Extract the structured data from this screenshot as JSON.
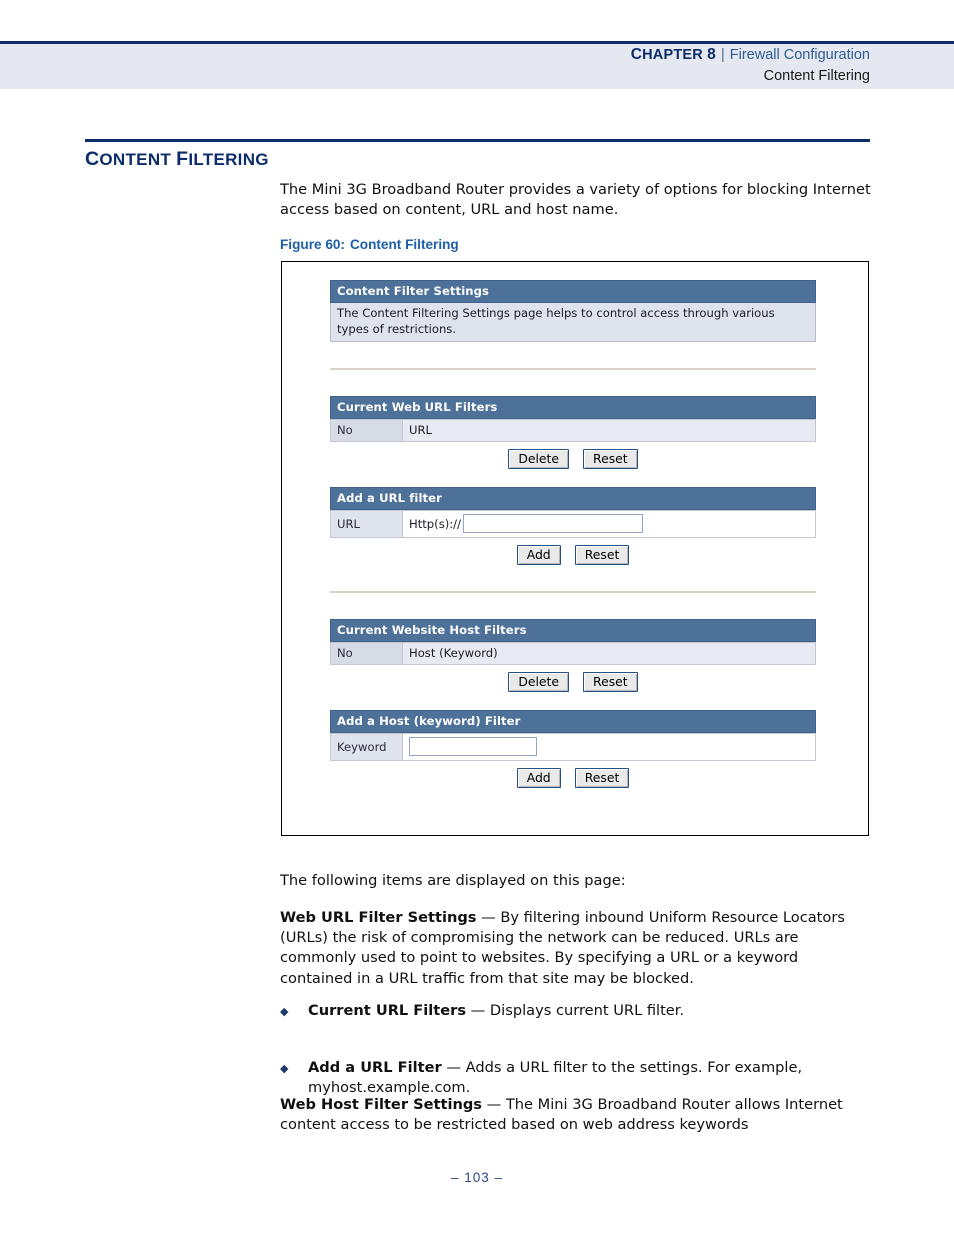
{
  "header": {
    "chapter_label": "Chapter 8",
    "separator": "|",
    "section": "Firewall Configuration",
    "subsection": "Content Filtering"
  },
  "section": {
    "title": "Content Filtering",
    "intro": "The Mini 3G Broadband Router provides a variety of options for blocking Internet access based on content, URL and host name."
  },
  "figure": {
    "caption_label": "Figure 60:",
    "caption_text": "Content Filtering",
    "screenshot": {
      "content_filter_settings": {
        "header": "Content Filter Settings",
        "description": "The Content Filtering Settings page helps to control access through various types of restrictions."
      },
      "current_web_url_filters": {
        "header": "Current Web URL Filters",
        "columns": [
          "No",
          "URL"
        ],
        "rows": [],
        "buttons": [
          "Delete",
          "Reset"
        ]
      },
      "add_a_url_filter": {
        "header": "Add a URL filter",
        "label": "URL",
        "prefix": "Http(s)://",
        "value": "",
        "buttons": [
          "Add",
          "Reset"
        ]
      },
      "current_website_host_filters": {
        "header": "Current Website Host Filters",
        "columns": [
          "No",
          "Host (Keyword)"
        ],
        "rows": [],
        "buttons": [
          "Delete",
          "Reset"
        ]
      },
      "add_a_host_keyword_filter": {
        "header": "Add a Host (keyword) Filter",
        "label": "Keyword",
        "value": "",
        "buttons": [
          "Add",
          "Reset"
        ]
      }
    }
  },
  "body": {
    "lead_in": "The following items are displayed on this page:",
    "web_url_filter_settings": {
      "term": "Web URL Filter Settings",
      "dash": " — ",
      "text": "By filtering inbound Uniform Resource Locators (URLs) the risk of compromising the network can be reduced. URLs are commonly used to point to websites. By specifying a URL or a keyword contained in a URL traffic from that site may be blocked."
    },
    "bullets": [
      {
        "marker": "◆",
        "term": "Current URL Filters",
        "dash": " — ",
        "text": "Displays current URL filter."
      },
      {
        "marker": "◆",
        "term": "Add a URL Filter",
        "dash": " — ",
        "text": "Adds a URL filter to the settings. For example, myhost.example.com."
      }
    ],
    "web_host_filter_settings": {
      "term": "Web Host Filter Settings",
      "dash": " — ",
      "text": "The Mini 3G Broadband Router allows Internet content access to be restricted based on web address keywords"
    }
  },
  "footer": {
    "page_number": "–  103  –"
  },
  "colors": {
    "navy": "#0d2d69",
    "header_band": "#e5e8f0",
    "caption_blue": "#1d5fa8",
    "ui_bar_blue": "#4e7199",
    "ui_desc_bg": "#dfe3ee",
    "ui_cell_bg": "#e8eaf2",
    "divider_tan": "#d8d2c4",
    "button_border": "#264f86"
  }
}
